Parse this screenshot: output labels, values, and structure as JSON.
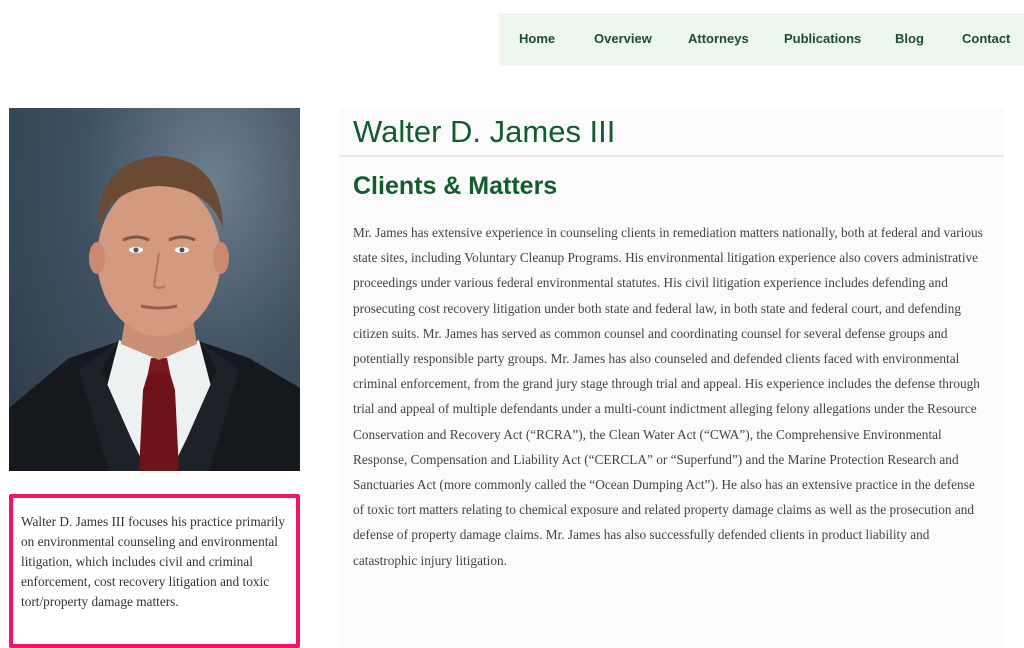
{
  "nav": {
    "items": [
      "Home",
      "Overview",
      "Attorneys",
      "Publications",
      "Blog",
      "Contact"
    ]
  },
  "sidebar": {
    "bio": "Walter D. James III focuses his practice primarily on environmental counseling and environmental litigation, which includes civil and criminal enforcement, cost recovery litigation and toxic tort/property damage matters."
  },
  "main": {
    "name": "Walter D. James III",
    "heading": "Clients & Matters",
    "body": "Mr. James has extensive experience in counseling clients in remediation matters nationally, both at federal and various state sites, including Voluntary Cleanup Programs. His environmental litigation experience also covers administrative proceedings under various federal environmental statutes. His civil litigation experience includes defending and prosecuting cost recovery litigation under both state and federal law, in both state and federal court, and defending citizen suits. Mr. James has served as common counsel and coordinating counsel for several defense groups and potentially responsible party groups. Mr. James has also counseled and defended clients faced with environmental criminal enforcement, from the grand jury stage through trial and appeal. His experience includes the defense through trial and appeal of multiple defendants under a multi-count indictment alleging felony allegations under the Resource Conservation and Recovery Act (“RCRA”), the Clean Water Act (“CWA”), the Comprehensive Environmental Response, Compensation and Liability Act (“CERCLA” or “Superfund”) and the Marine Protection Research and Sanctuaries Act (more commonly called the “Ocean Dumping Act”). He also has an extensive practice in the defense of toxic tort matters relating to chemical exposure and related property damage claims as well as the prosecution and defense of property damage claims. Mr. James has also successfully defended clients in product liability and catastrophic injury litigation."
  },
  "colors": {
    "brand_green": "#125c2e",
    "nav_bg": "#edf7ed",
    "highlight": "#f0156a"
  }
}
